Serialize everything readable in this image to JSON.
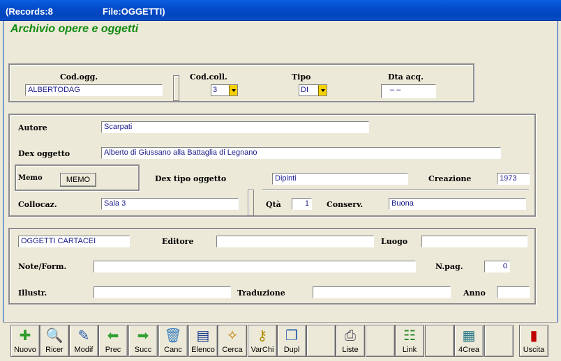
{
  "title": {
    "records": "(Records:8",
    "file": "File:OGGETTI)"
  },
  "app_title": "Archivio opere e oggetti",
  "top": {
    "cod_ogg_label": "Cod.ogg.",
    "cod_ogg_value": "ALBERTODAG",
    "cod_coll_label": "Cod.coll.",
    "cod_coll_value": "3",
    "tipo_label": "Tipo",
    "tipo_value": "DI",
    "dta_acq_label": "Dta acq.",
    "dta_acq_value": "  –   –"
  },
  "mid": {
    "autore_label": "Autore",
    "autore_value": "Scarpati",
    "dex_oggetto_label": "Dex oggetto",
    "dex_oggetto_value": "Alberto di Giussano alla Battaglia di Legnano",
    "memo_label": "Memo",
    "memo_button": "MEMO",
    "dex_tipo_label": "Dex tipo oggetto",
    "dex_tipo_value": "Dipinti",
    "creazione_label": "Creazione",
    "creazione_value": "1973",
    "collocaz_label": "Collocaz.",
    "collocaz_value": "Sala 3",
    "qta_label": "Qtà",
    "qta_value": "1",
    "conserv_label": "Conserv.",
    "conserv_value": "Buona"
  },
  "bottom": {
    "categoria_value": "OGGETTI CARTACEI",
    "editore_label": "Editore",
    "editore_value": "",
    "luogo_label": "Luogo",
    "luogo_value": "",
    "note_label": "Note/Form.",
    "note_value": "",
    "npag_label": "N.pag.",
    "npag_value": "0",
    "illustr_label": "Illustr.",
    "illustr_value": "",
    "traduzione_label": "Traduzione",
    "traduzione_value": "",
    "anno_label": "Anno",
    "anno_value": ""
  },
  "toolbar": [
    {
      "label": "Nuovo",
      "icon": "new-document-icon"
    },
    {
      "label": "Ricer",
      "icon": "magnifier-icon"
    },
    {
      "label": "Modif",
      "icon": "edit-document-icon"
    },
    {
      "label": "Prec",
      "icon": "arrow-left-icon"
    },
    {
      "label": "Succ",
      "icon": "arrow-right-icon"
    },
    {
      "label": "Canc",
      "icon": "trash-icon"
    },
    {
      "label": "Elenco",
      "icon": "list-icon"
    },
    {
      "label": "Cerca",
      "icon": "search-brush-icon"
    },
    {
      "label": "VarChi",
      "icon": "keys-icon"
    },
    {
      "label": "Dupl",
      "icon": "copy-icon"
    },
    {
      "label": "",
      "icon": ""
    },
    {
      "label": "Liste",
      "icon": "printer-icon"
    },
    {
      "label": "",
      "icon": ""
    },
    {
      "label": "Link",
      "icon": "tree-icon"
    },
    {
      "label": "",
      "icon": ""
    },
    {
      "label": "4Crea",
      "icon": "build-icon"
    },
    {
      "label": "",
      "icon": ""
    },
    {
      "label": "Uscita",
      "icon": "exit-door-icon"
    }
  ],
  "colors": {
    "titlebar": "#0349c8",
    "app_title": "#118a11",
    "field_text": "#1a1a8c"
  }
}
